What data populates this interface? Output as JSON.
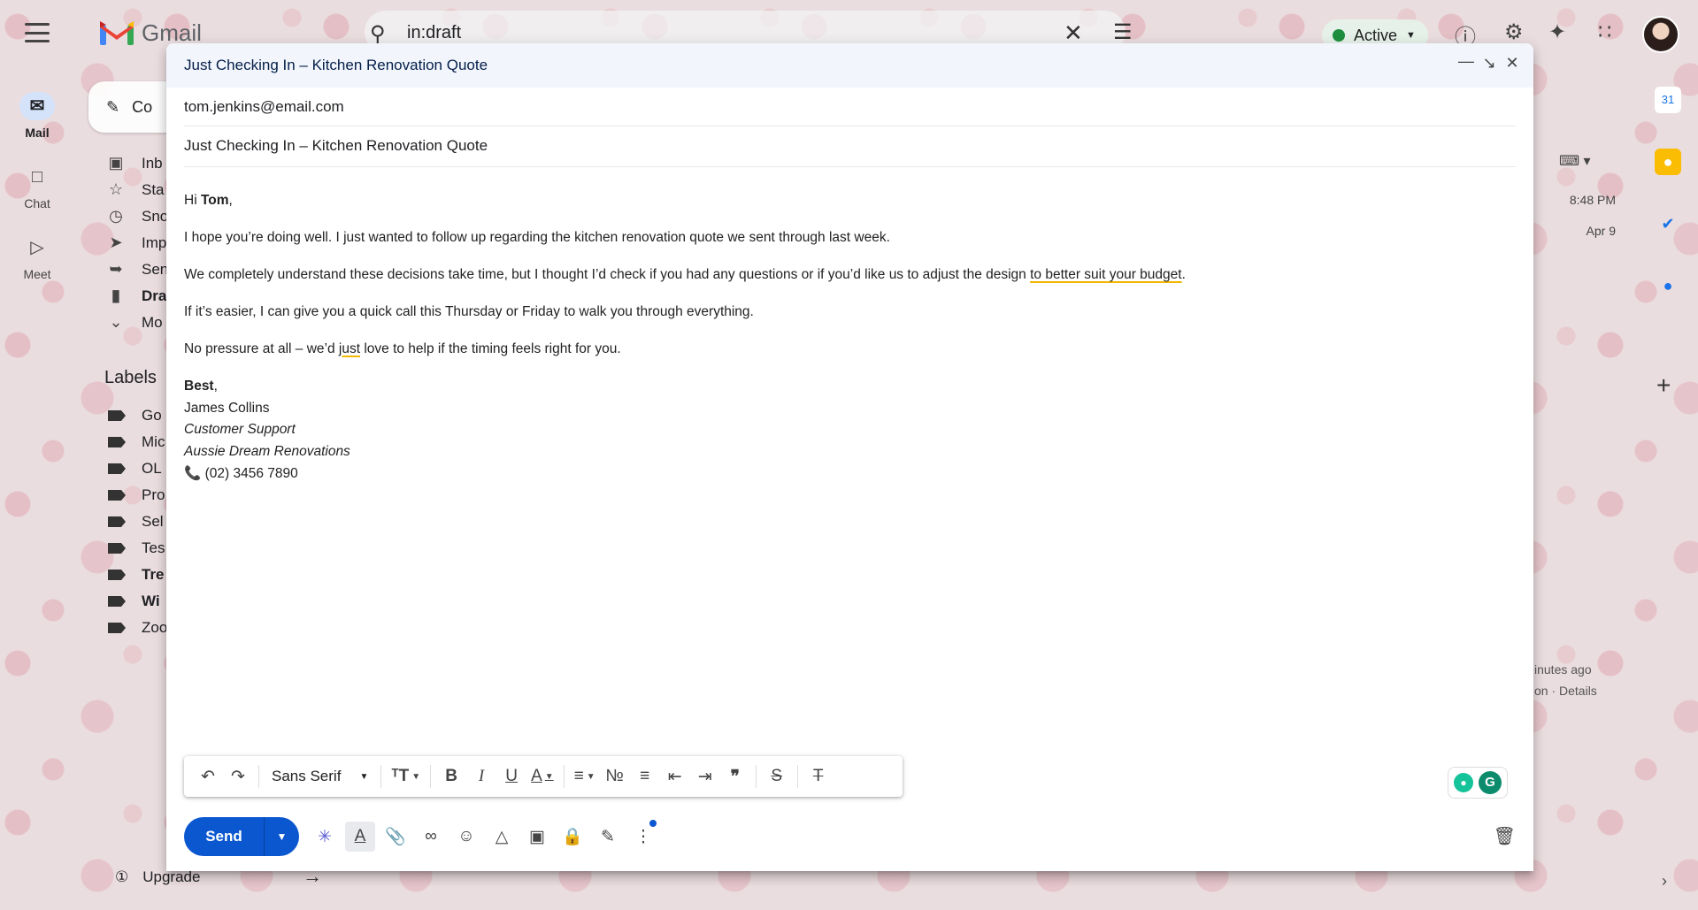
{
  "app": {
    "name": "Gmail"
  },
  "search": {
    "query": "in:draft"
  },
  "status": {
    "label": "Active",
    "color": "#1e8e3e"
  },
  "rail": [
    {
      "label": "Mail",
      "icon": "mail-icon"
    },
    {
      "label": "Chat",
      "icon": "chat-icon"
    },
    {
      "label": "Meet",
      "icon": "meet-icon"
    }
  ],
  "sidebar": {
    "compose_label": "Co",
    "items": [
      {
        "label": "Inb",
        "icon": "inbox-icon",
        "bold": false
      },
      {
        "label": "Sta",
        "icon": "star-icon",
        "bold": false
      },
      {
        "label": "Sno",
        "icon": "clock-icon",
        "bold": false
      },
      {
        "label": "Imp",
        "icon": "important-icon",
        "bold": false
      },
      {
        "label": "Sen",
        "icon": "send-icon",
        "bold": false
      },
      {
        "label": "Dra",
        "icon": "draft-icon",
        "bold": true
      },
      {
        "label": "Mo",
        "icon": "chevron-down-icon",
        "bold": false
      }
    ],
    "labels_heading": "Labels",
    "labels": [
      {
        "label": "Go",
        "bold": false
      },
      {
        "label": "Mic",
        "bold": false
      },
      {
        "label": "OL",
        "bold": false
      },
      {
        "label": "Pro",
        "bold": false
      },
      {
        "label": "Sel",
        "bold": false
      },
      {
        "label": "Tes",
        "bold": false
      },
      {
        "label": "Tre",
        "bold": true
      },
      {
        "label": "Wi",
        "bold": true
      },
      {
        "label": "Zoo",
        "bold": false
      }
    ],
    "upgrade_label": "Upgrade"
  },
  "list": {
    "times": [
      "8:48 PM",
      "Apr 9"
    ],
    "meta_1": "inutes ago",
    "meta_2": "on · Details"
  },
  "compose": {
    "title": "Just Checking In – Kitchen Renovation Quote",
    "to": "tom.jenkins@email.com",
    "subject": "Just Checking In – Kitchen Renovation Quote",
    "greeting_hi": "Hi ",
    "greeting_name": "Tom",
    "greeting_comma": ",",
    "para1": "I hope you’re doing well. I just wanted to follow up regarding the kitchen renovation quote we sent through last week.",
    "para2_start": "We completely understand these decisions take time, but I thought I’d check if you had any questions or if you’d like us to adjust the design ",
    "para2_flag": "to better suit your budget",
    "para2_end": ".",
    "para3": "If it’s easier, I can give you a quick call this Thursday or Friday to walk you through everything.",
    "para4_start": "No pressure at all – we’d ",
    "para4_flag": "just",
    "para4_end": " love to help if the timing feels right for you.",
    "sign_off": "Best",
    "sign_off_comma": ",",
    "sig_name": "James Collins",
    "sig_role": "Customer Support",
    "sig_company": "Aussie Dream Renovations",
    "sig_phone": "(02) 3456 7890"
  },
  "toolbar": {
    "font": "Sans Serif"
  },
  "send": {
    "label": "Send",
    "color": "#0b57d0"
  }
}
